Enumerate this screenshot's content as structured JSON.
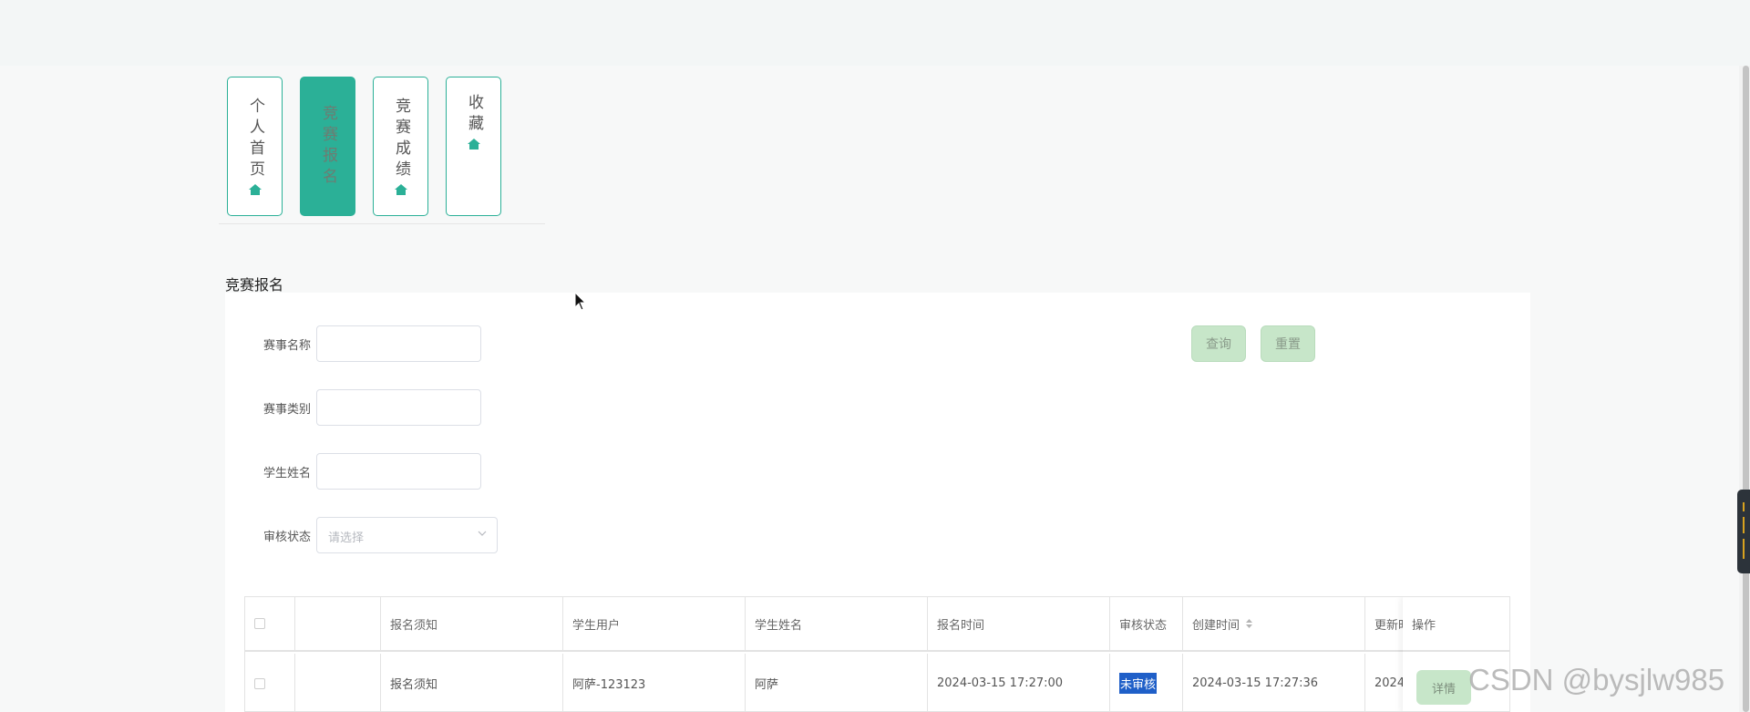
{
  "nav": {
    "items": [
      {
        "label": "个人首页",
        "icon": "home-icon",
        "active": false
      },
      {
        "label": "竞赛报名",
        "icon": "home-icon",
        "active": true
      },
      {
        "label": "竞赛成绩",
        "icon": "home-icon",
        "active": false
      },
      {
        "label": "收藏",
        "icon": "home-icon",
        "active": false
      }
    ]
  },
  "page_title": "竞赛报名",
  "search_form": {
    "fields": [
      {
        "label": "赛事名称",
        "value": ""
      },
      {
        "label": "赛事类别",
        "value": ""
      },
      {
        "label": "学生姓名",
        "value": ""
      }
    ],
    "status_select": {
      "label": "审核状态",
      "placeholder": "请选择"
    },
    "query_label": "查询",
    "reset_label": "重置"
  },
  "table": {
    "headers": [
      "",
      "",
      "报名须知",
      "学生用户",
      "学生姓名",
      "报名时间",
      "审核状态",
      "创建时间",
      "更新时",
      "操作"
    ],
    "rows": [
      {
        "notice": "报名须知",
        "user": "阿萨-123123",
        "name": "阿萨",
        "signup_time": "2024-03-15 17:27:00",
        "status": "未审核",
        "created": "2024-03-15 17:27:36",
        "updated": "2024",
        "action": "详情"
      }
    ]
  },
  "watermark": "CSDN @bysjlw985",
  "colors": {
    "accent": "#2bb097",
    "button_bg": "#c7e6c9",
    "highlight": "#1f5fc8"
  }
}
